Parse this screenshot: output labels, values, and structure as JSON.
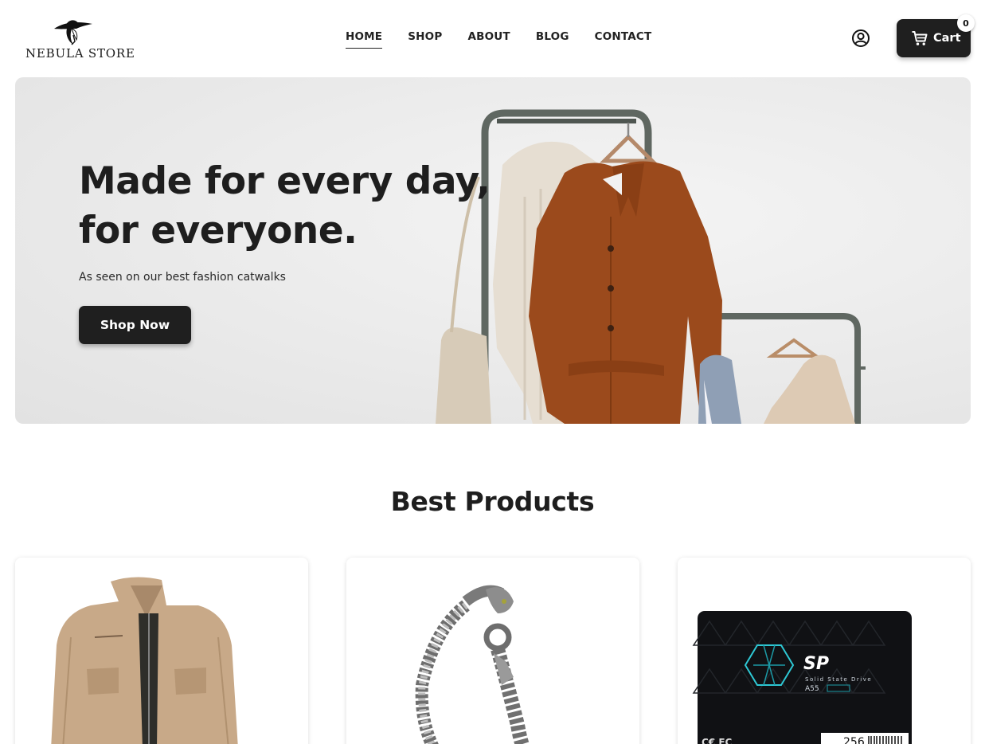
{
  "brand": {
    "name": "NEBULA STORE",
    "logo_icon": "woman-hat-icon"
  },
  "nav": {
    "items": [
      {
        "label": "HOME",
        "active": true
      },
      {
        "label": "SHOP",
        "active": false
      },
      {
        "label": "ABOUT",
        "active": false
      },
      {
        "label": "BLOG",
        "active": false
      },
      {
        "label": "CONTACT",
        "active": false
      }
    ]
  },
  "header": {
    "user_icon": "user-circle-icon",
    "cart": {
      "label": "Cart",
      "count": "0",
      "icon": "shopping-cart-icon"
    }
  },
  "hero": {
    "title": "Made for every day, for everyone.",
    "subtitle": "As seen on our best fashion catwalks",
    "cta": "Shop Now"
  },
  "products_section": {
    "title": "Best Products",
    "products": [
      {
        "image": "khaki-jacket"
      },
      {
        "image": "silver-dragon-bracelet"
      },
      {
        "image": "sp-ssd-drive",
        "text": {
          "brand_mark": "SP",
          "line1": "Solid State Drive",
          "model": "A55",
          "capacity": "256"
        }
      }
    ]
  },
  "colors": {
    "accent_dark": "#1f1f1f",
    "hero_bg": "#ececec",
    "coat": "#9b4a1c"
  }
}
